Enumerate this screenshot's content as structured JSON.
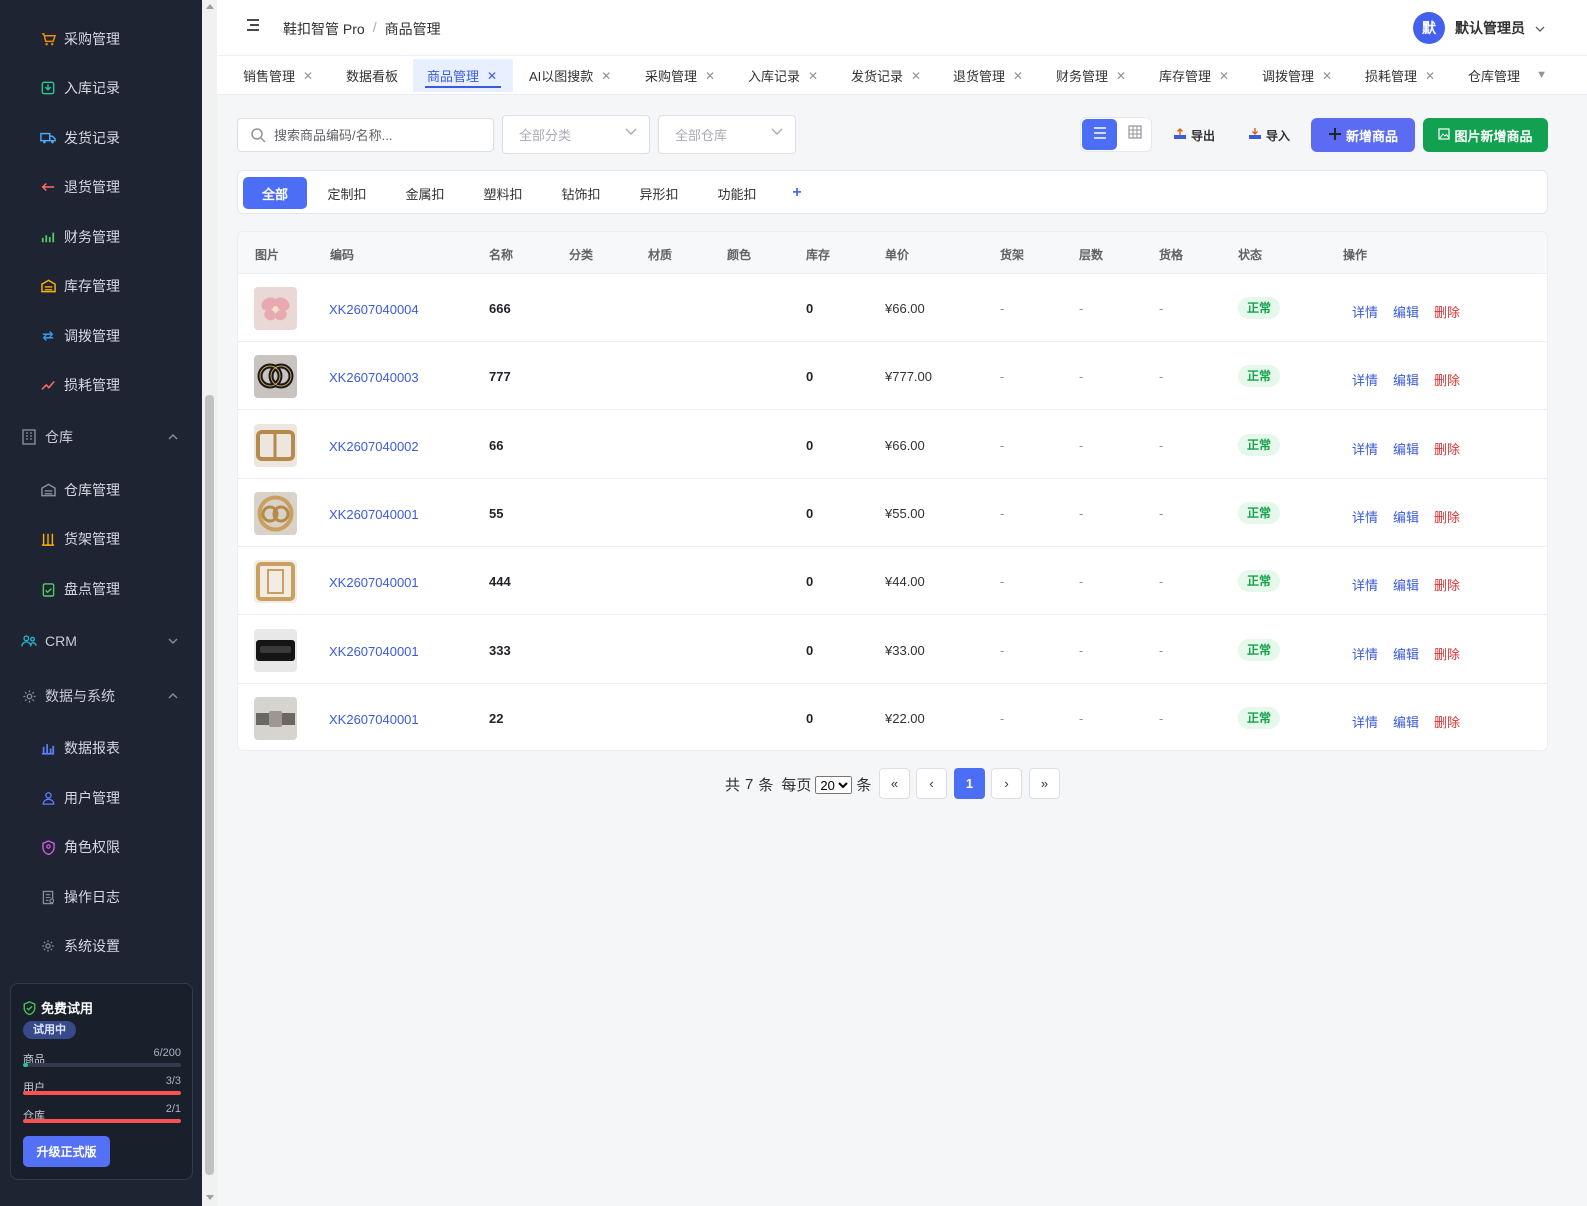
{
  "sidebar": {
    "items": [
      {
        "label": "采购管理",
        "icon": "cart-icon"
      },
      {
        "label": "入库记录",
        "icon": "inbox-icon"
      },
      {
        "label": "发货记录",
        "icon": "truck-icon"
      },
      {
        "label": "退货管理",
        "icon": "return-icon"
      },
      {
        "label": "财务管理",
        "icon": "finance-chart-icon"
      },
      {
        "label": "库存管理",
        "icon": "warehouse-icon"
      },
      {
        "label": "调拨管理",
        "icon": "transfer-icon"
      },
      {
        "label": "损耗管理",
        "icon": "trend-icon"
      }
    ],
    "group_warehouse": {
      "label": "仓库",
      "items": [
        {
          "label": "仓库管理",
          "icon": "warehouse-icon"
        },
        {
          "label": "货架管理",
          "icon": "shelf-icon"
        },
        {
          "label": "盘点管理",
          "icon": "clipboard-check-icon"
        }
      ]
    },
    "group_crm": {
      "label": "CRM"
    },
    "group_system": {
      "label": "数据与系统",
      "items": [
        {
          "label": "数据报表",
          "icon": "bar-chart-icon"
        },
        {
          "label": "用户管理",
          "icon": "user-icon"
        },
        {
          "label": "角色权限",
          "icon": "shield-user-icon"
        },
        {
          "label": "操作日志",
          "icon": "log-icon"
        },
        {
          "label": "系统设置",
          "icon": "gear-icon"
        }
      ]
    },
    "trial": {
      "title": "免费试用",
      "badge": "试用中",
      "quotas": [
        {
          "label": "商品",
          "value": "6/200",
          "ratio": 0.03
        },
        {
          "label": "用户",
          "value": "3/3",
          "ratio": 1.0
        },
        {
          "label": "仓库",
          "value": "2/1",
          "ratio": 1.0
        }
      ],
      "upgrade_label": "升级正式版"
    }
  },
  "header": {
    "app_name": "鞋扣智管 Pro",
    "separator": "/",
    "page": "商品管理",
    "user_avatar": "默",
    "user_name": "默认管理员"
  },
  "tabs": [
    {
      "label": "销售管理",
      "closable": true
    },
    {
      "label": "数据看板",
      "closable": false
    },
    {
      "label": "商品管理",
      "closable": true,
      "active": true
    },
    {
      "label": "AI以图搜款",
      "closable": true
    },
    {
      "label": "采购管理",
      "closable": true
    },
    {
      "label": "入库记录",
      "closable": true
    },
    {
      "label": "发货记录",
      "closable": true
    },
    {
      "label": "退货管理",
      "closable": true
    },
    {
      "label": "财务管理",
      "closable": true
    },
    {
      "label": "库存管理",
      "closable": true
    },
    {
      "label": "调拨管理",
      "closable": true
    },
    {
      "label": "损耗管理",
      "closable": true
    },
    {
      "label": "仓库管理",
      "closable": false
    }
  ],
  "tab_close_glyph": "✕",
  "toolbar": {
    "search_placeholder": "搜索商品编码/名称...",
    "category_placeholder": "全部分类",
    "warehouse_placeholder": "全部仓库",
    "export_label": "导出",
    "import_label": "导入",
    "add_label": "新增商品",
    "add_by_image_label": "图片新增商品"
  },
  "categories": [
    "全部",
    "定制扣",
    "金属扣",
    "塑料扣",
    "钻饰扣",
    "异形扣",
    "功能扣"
  ],
  "category_add": "+",
  "table": {
    "headers": [
      "图片",
      "编码",
      "名称",
      "分类",
      "材质",
      "颜色",
      "库存",
      "单价",
      "货架",
      "层数",
      "货格",
      "状态",
      "操作"
    ],
    "rows": [
      {
        "code": "XK2607040004",
        "name": "666",
        "category": "",
        "material": "",
        "color": "",
        "stock": "0",
        "price": "¥66.00",
        "shelf": "-",
        "layer": "-",
        "slot": "-",
        "status": "正常"
      },
      {
        "code": "XK2607040003",
        "name": "777",
        "category": "",
        "material": "",
        "color": "",
        "stock": "0",
        "price": "¥777.00",
        "shelf": "-",
        "layer": "-",
        "slot": "-",
        "status": "正常"
      },
      {
        "code": "XK2607040002",
        "name": "66",
        "category": "",
        "material": "",
        "color": "",
        "stock": "0",
        "price": "¥66.00",
        "shelf": "-",
        "layer": "-",
        "slot": "-",
        "status": "正常"
      },
      {
        "code": "XK2607040001",
        "name": "55",
        "category": "",
        "material": "",
        "color": "",
        "stock": "0",
        "price": "¥55.00",
        "shelf": "-",
        "layer": "-",
        "slot": "-",
        "status": "正常"
      },
      {
        "code": "XK2607040001",
        "name": "444",
        "category": "",
        "material": "",
        "color": "",
        "stock": "0",
        "price": "¥44.00",
        "shelf": "-",
        "layer": "-",
        "slot": "-",
        "status": "正常"
      },
      {
        "code": "XK2607040001",
        "name": "333",
        "category": "",
        "material": "",
        "color": "",
        "stock": "0",
        "price": "¥33.00",
        "shelf": "-",
        "layer": "-",
        "slot": "-",
        "status": "正常"
      },
      {
        "code": "XK2607040001",
        "name": "22",
        "category": "",
        "material": "",
        "color": "",
        "stock": "0",
        "price": "¥22.00",
        "shelf": "-",
        "layer": "-",
        "slot": "-",
        "status": "正常"
      }
    ],
    "actions": {
      "detail": "详情",
      "edit": "编辑",
      "delete": "删除"
    }
  },
  "pagination": {
    "total_prefix": "共",
    "total": "7",
    "total_suffix": "条",
    "per_page_label": "每页",
    "per_page_value": "20",
    "per_page_suffix": "条",
    "first": "«",
    "prev": "‹",
    "current": "1",
    "next": "›",
    "last": "»"
  },
  "colors": {
    "sidebar_bg": "#1f2433",
    "primary": "#4c6ef5",
    "success": "#16a34a",
    "danger": "#e03131",
    "link": "#3b5bdb"
  }
}
